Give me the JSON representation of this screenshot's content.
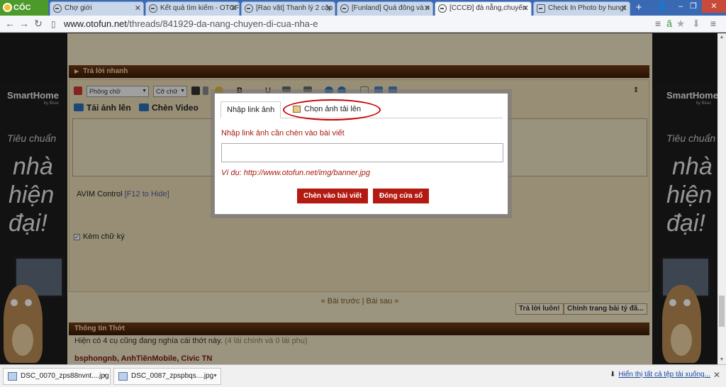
{
  "browser": {
    "brand": "CỐC CỐC",
    "tabs": [
      {
        "label": "Chợ giới"
      },
      {
        "label": "Kết quả tìm kiếm - OTOF"
      },
      {
        "label": "[Rao vặt] Thanh lý 2 cặp"
      },
      {
        "label": "[Funland] Quá đông và n"
      },
      {
        "label": "[CCCĐ] đà nẵng,chuyến"
      },
      {
        "label": "Check In Photo by hungt"
      }
    ],
    "new_tab": "+",
    "url_host": "www.otofun.net",
    "url_path": "/threads/841929-da-nang-chuyen-di-cua-nha-e"
  },
  "ad": {
    "brand": "SmartHome",
    "by": "by Bkav",
    "slogan_small": "Tiêu chuẩn",
    "slogan_lines": [
      "nhà",
      "hiện",
      "đại!"
    ]
  },
  "forum": {
    "quick_reply_title": "Trả lời nhanh",
    "font_select": "Phông chữ",
    "size_select": "Cỡ chữ",
    "upload_image": "Tải ảnh lên",
    "record_video": "Chèn Video",
    "avim_label": "AVIM Control",
    "avim_hint": "[F12 to Hide]",
    "signature_label": "Kèm chữ ký",
    "submit_button": "Trả lời luôn!",
    "advanced_button": "Chỉnh trang bài tý đã...",
    "prev_thread": "« Bài trước",
    "next_thread": "Bài sau »",
    "thread_info_title": "Thông tin Thớt",
    "viewers_text": "Hiện có 4 cụ cũng đang nghía cái thớt này.",
    "viewers_detail": "(4 lái chính và 0 lái phụ)",
    "viewer_names": "bsphongnb, AnhTiênMobile, Civic TN"
  },
  "dialog": {
    "tab_link": "Nhập link ảnh",
    "tab_upload": "Chọn ảnh tải lên",
    "label": "Nhập link ảnh cần chèn vào bài viết",
    "input_value": "",
    "example": "Ví dụ: http://www.otofun.net/img/banner.jpg",
    "insert_button": "Chèn vào bài viết",
    "close_button": "Đóng cửa sổ"
  },
  "downloads": {
    "items": [
      {
        "name": "DSC_0070_zps88nvnt....jpg"
      },
      {
        "name": "DSC_0087_zpspbqs....jpg"
      }
    ],
    "show_all": "Hiển thị tất cả tệp tải xuống..."
  },
  "colors": {
    "accent": "#b31b12",
    "forum_bg": "#efe3c4",
    "tabbar": "#3a69b3",
    "highlight_ring": "#cc0000"
  }
}
